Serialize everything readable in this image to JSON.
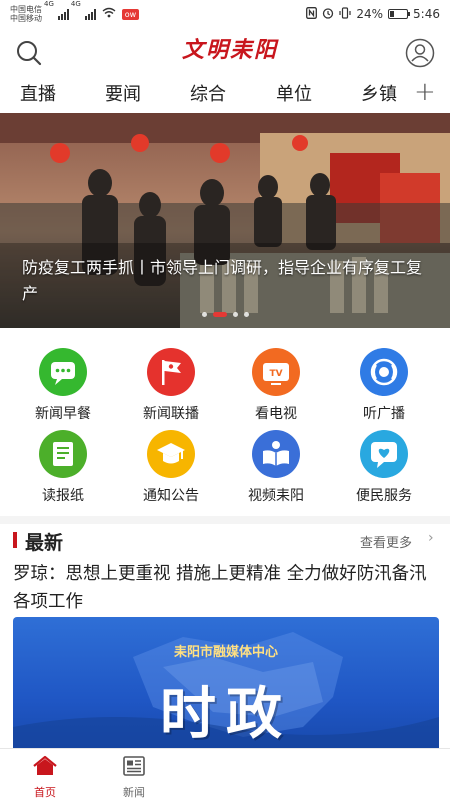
{
  "status": {
    "carrier1": "中国电信",
    "carrier2": "中国移动",
    "sig1": "4G",
    "sig2": "4G",
    "app_badge": "ow",
    "battery_text": "24%",
    "battery_level": 0.24,
    "time": "5:46"
  },
  "header": {
    "logo_text": "文明耒阳"
  },
  "tabs": [
    "直播",
    "要闻",
    "综合",
    "单位",
    "乡镇"
  ],
  "banner": {
    "caption": "防疫复工两手抓丨市领导上门调研，指导企业有序复工复产",
    "dot_count": 4,
    "active_dot": 1
  },
  "grid": {
    "items": [
      {
        "label": "新闻早餐",
        "icon": "chat-bubble-icon",
        "color": "#35b82f"
      },
      {
        "label": "新闻联播",
        "icon": "party-flag-icon",
        "color": "#e5322d"
      },
      {
        "label": "看电视",
        "icon": "tv-icon",
        "color": "#f26a21"
      },
      {
        "label": "听广播",
        "icon": "radio-wave-icon",
        "color": "#2f7be5"
      },
      {
        "label": "读报纸",
        "icon": "newspaper-icon",
        "color": "#4caf2a"
      },
      {
        "label": "通知公告",
        "icon": "graduation-cap-icon",
        "color": "#f7b500"
      },
      {
        "label": "视频耒阳",
        "icon": "book-person-icon",
        "color": "#3a6fd8"
      },
      {
        "label": "便民服务",
        "icon": "heart-chat-icon",
        "color": "#29a8e0"
      }
    ]
  },
  "latest": {
    "title": "最新",
    "more": "查看更多",
    "headline": "罗琼：思想上更重视 措施上更精准 全力做好防汛备汛各项工作",
    "image_org": "耒阳市融媒体中心",
    "image_word": "时政"
  },
  "bottom_nav": {
    "home": "首页",
    "news": "新闻"
  },
  "colors": {
    "brand_red": "#c8161d"
  }
}
